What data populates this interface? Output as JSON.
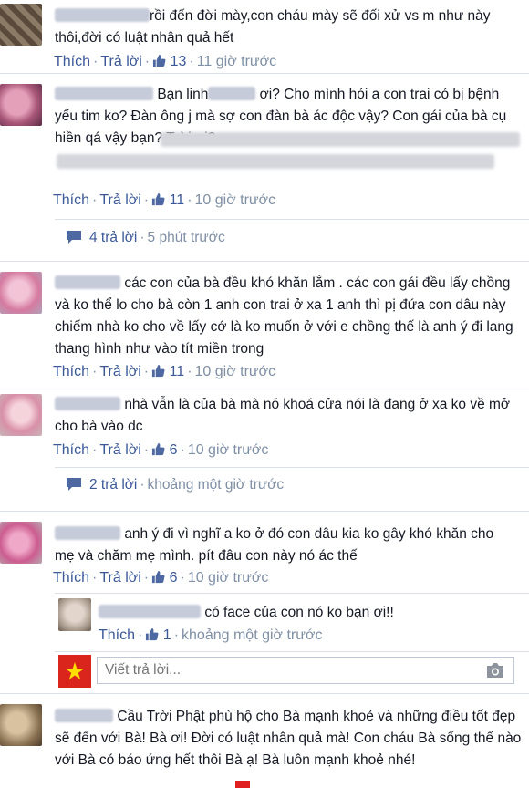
{
  "ui": {
    "like_label": "Thích",
    "reply_label": "Trả lời",
    "reply_input_placeholder": "Viết trả lời..."
  },
  "colors": {
    "link": "#3b5998",
    "meta": "#7f8fa4",
    "separator": "#dde0e6"
  },
  "comments": [
    {
      "text": "rồi đến đời mày,con cháu mày sẽ đối xử vs m như này thôi,đời có luật nhân quả hết",
      "likes": "13",
      "time": "11 giờ trước"
    },
    {
      "text_a": "Bạn linh",
      "text_b": "ơi? Cho mình hỏi a con trai có bị bệnh yếu tim ko? Đàn ông j mà sợ con đàn bà ác độc vậy? Con gái của bà cụ hiền qá vậy bạn? Trời ơi?",
      "likes": "11",
      "time": "10 giờ trước",
      "replies_summary": "4 trả lời",
      "replies_time": "5 phút trước"
    },
    {
      "text": "các con của bà đều khó khăn lắm . các con gái đều lấy chồng và ko thể lo cho bà còn 1 anh con trai ở xa 1 anh thì pị đứa con dâu này chiếm nhà ko cho về lấy cớ là ko muốn ở với e chồng thế là anh ý đi lang thang hình như vào tít miền trong",
      "likes": "11",
      "time": "10 giờ trước"
    },
    {
      "text": "nhà vẫn là của bà mà nó khoá cửa nói là đang ở xa ko về mở cho bà vào dc",
      "likes": "6",
      "time": "10 giờ trước",
      "replies_summary": "2 trả lời",
      "replies_time": "khoảng một giờ trước"
    },
    {
      "text": "anh ý đi vì nghĩ a ko ở đó con dâu kia ko gây khó khăn cho mẹ và chăm mẹ mình. pít đâu con này nó ác thế",
      "likes": "6",
      "time": "10 giờ trước",
      "reply": {
        "text": "có face của con nó ko bạn ơi!!",
        "likes": "1",
        "time": "khoảng một giờ trước"
      }
    },
    {
      "text": "Cầu Trời Phật phù hộ cho Bà mạnh khoẻ và những điều tốt đẹp sẽ đến với Bà! Bà ơi! Đời có luật nhân quả mà! Con cháu Bà sống thế nào với Bà có báo ứng hết thôi Bà ạ! Bà luôn mạnh khoẻ nhé!"
    }
  ]
}
